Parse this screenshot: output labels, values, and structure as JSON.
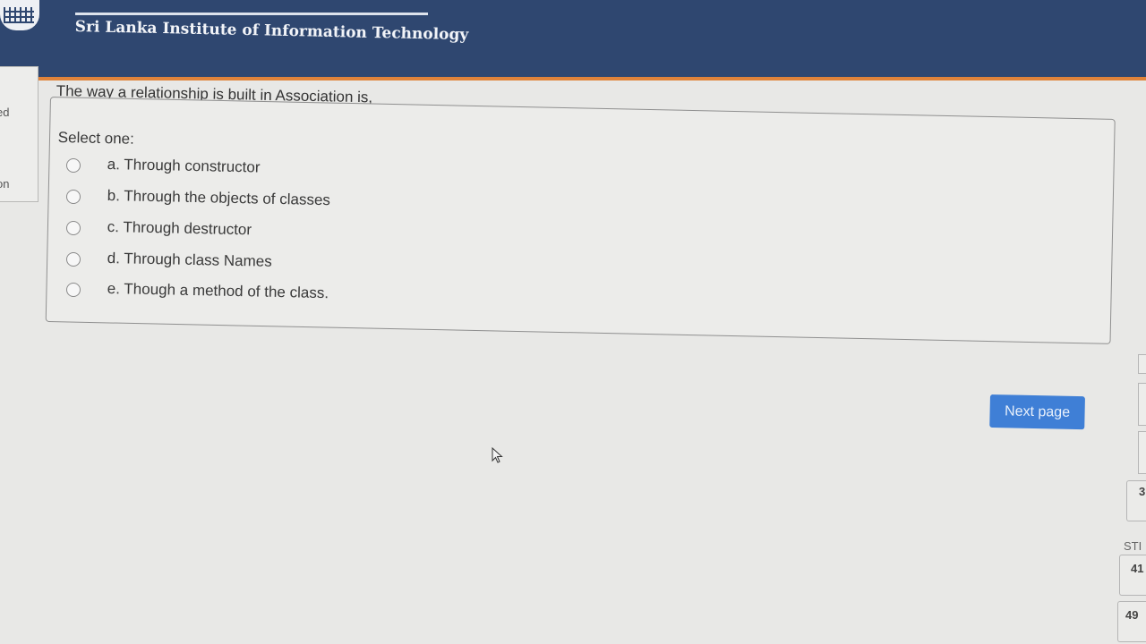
{
  "header": {
    "institute_name": "Sri Lanka Institute of Information Technology"
  },
  "left_sidebar": {
    "fragment_1": "ed",
    "fragment_2": "on"
  },
  "question": {
    "text": "The way a relationship is built in Association is,",
    "prompt": "Select one:",
    "options": [
      {
        "label": "a. Through constructor",
        "selected": false
      },
      {
        "label": "b. Through the objects of classes",
        "selected": false
      },
      {
        "label": "c. Through destructor",
        "selected": false
      },
      {
        "label": "d. Through class Names",
        "selected": false
      },
      {
        "label": "e. Though a method of the class.",
        "selected": false
      }
    ]
  },
  "navigation": {
    "next_label": "Next page"
  },
  "quiz_nav": {
    "fragment_3": "3",
    "fragment_stf": "STI",
    "fragment_41": "41",
    "fragment_49": "49"
  },
  "colors": {
    "header": "#2f4770",
    "accent": "#e0833a",
    "button": "#3f7fd6"
  }
}
